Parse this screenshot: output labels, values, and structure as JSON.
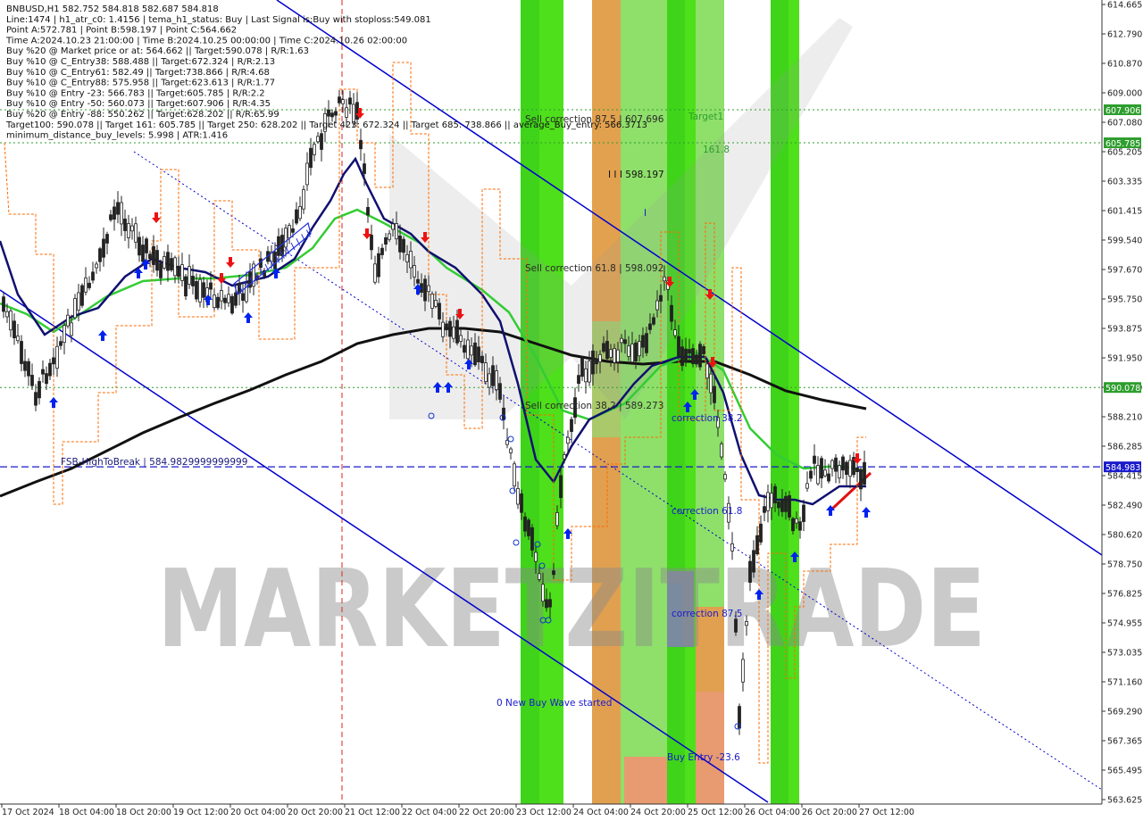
{
  "info_lines": [
    "BNBUSD,H1  582.752 584.818 582.687 584.818",
    "Line:1474 | h1_atr_c0: 1.4156 | tema_h1_status: Buy | Last Signal is:Buy with stoploss:549.081",
    "Point A:572.781 | Point B:598.197 | Point C:564.662",
    "Time A:2024.10.23 21:00:00 | Time B:2024.10.25 00:00:00 | Time C:2024.10.26 02:00:00",
    "Buy %20 @ Market price or at: 564.662 || Target:590.078 | R/R:1.63",
    "Buy %10 @ C_Entry38: 588.488 || Target:672.324 | R/R:2.13",
    "Buy %10 @ C_Entry61: 582.49 || Target:738.866 | R/R:4.68",
    "Buy %10 @ C_Entry88: 575.958 || Target:623.613 | R/R:1.77",
    "Buy %10 @ Entry -23: 566.783 || Target:605.785 | R/R:2.2",
    "Buy %10 @ Entry -50: 560.073 || Target:607.906 | R/R:4.35",
    "Buy %20 @ Entry -88: 550.262 || Target:628.202 || R/R:65.99",
    "Target100: 590.078 || Target 161: 605.785 || Target 250: 628.202 || Target 423: 672.324 || Target 685: 738.866 || average_Buy_entry: 566.3713",
    "minimum_distance_buy_levels: 5.998 | ATR:1.416"
  ],
  "price_ticks": [
    "614.665",
    "612.790",
    "610.870",
    "609.000",
    "607.080",
    "605.205",
    "603.335",
    "601.415",
    "599.540",
    "597.670",
    "595.750",
    "593.875",
    "591.950",
    "590.080",
    "588.210",
    "586.285",
    "584.415",
    "582.490",
    "580.620",
    "578.750",
    "576.825",
    "574.955",
    "573.035",
    "571.160",
    "569.290",
    "567.365",
    "565.495",
    "563.625"
  ],
  "time_ticks": [
    "17 Oct 2024",
    "18 Oct 04:00",
    "18 Oct 20:00",
    "19 Oct 12:00",
    "20 Oct 04:00",
    "20 Oct 20:00",
    "21 Oct 12:00",
    "22 Oct 04:00",
    "22 Oct 20:00",
    "23 Oct 12:00",
    "24 Oct 04:00",
    "24 Oct 20:00",
    "25 Oct 12:00",
    "26 Oct 04:00",
    "26 Oct 20:00",
    "27 Oct 12:00"
  ],
  "price_tags": [
    {
      "text": "607.906",
      "value": 607.906,
      "color": "#2e9e2e"
    },
    {
      "text": "605.785",
      "value": 605.785,
      "color": "#2e9e2e"
    },
    {
      "text": "590.078",
      "value": 590.078,
      "color": "#2e9e2e"
    },
    {
      "text": "584.983",
      "value": 584.983,
      "color": "#1a1acc"
    }
  ],
  "annotations": {
    "sell_corr_875": "Sell correction 87.5 | 607.696",
    "target1": "Target1",
    "fib_1618": "161.8",
    "point_b": "I I I 598.197",
    "point_b_mark": "I",
    "sell_corr_618": "Sell correction 61.8 | 598.092",
    "sell_corr_382": "Sell correction 38.2 | 589.273",
    "corr_382": "correction 38.2",
    "corr_618": "correction 61.8",
    "corr_875": "correction 87.5",
    "fsb": "FSB-HighToBreak  |  584.9829999999999",
    "new_buy_wave": "0 New Buy Wave started",
    "buy_entry": "Buy Entry -23.6"
  },
  "watermark": "MARKETZITRADE",
  "colors": {
    "bull_zone": "#4ee01a",
    "bull_zone_light": "#8ee06a",
    "orange_zone": "#e0a050",
    "salmon_zone": "#e89a70",
    "gray_zone": "#7a8aa0",
    "channel": "#0000cc",
    "ma_black": "#111111",
    "ma_green": "#33cc33",
    "ma_navy": "#101070",
    "stop_orange": "#ff6a00",
    "level_green": "#2e9e2e",
    "fsb_line": "#1a1acc"
  },
  "chart_data": {
    "type": "candlestick",
    "symbol": "BNBUSD",
    "timeframe": "H1",
    "ohlc_last": {
      "open": 582.752,
      "high": 584.818,
      "low": 582.687,
      "close": 584.818
    },
    "ylim": [
      563.625,
      614.665
    ],
    "x_range": [
      "17 Oct 2024",
      "27 Oct 12:00"
    ],
    "horizontal_levels": [
      {
        "label": "607.906",
        "value": 607.906
      },
      {
        "label": "605.785",
        "value": 605.785
      },
      {
        "label": "590.078",
        "value": 590.078
      },
      {
        "label": "FSB-HighToBreak",
        "value": 584.983
      }
    ],
    "points": {
      "A": 572.781,
      "B": 598.197,
      "C": 564.662
    }
  }
}
